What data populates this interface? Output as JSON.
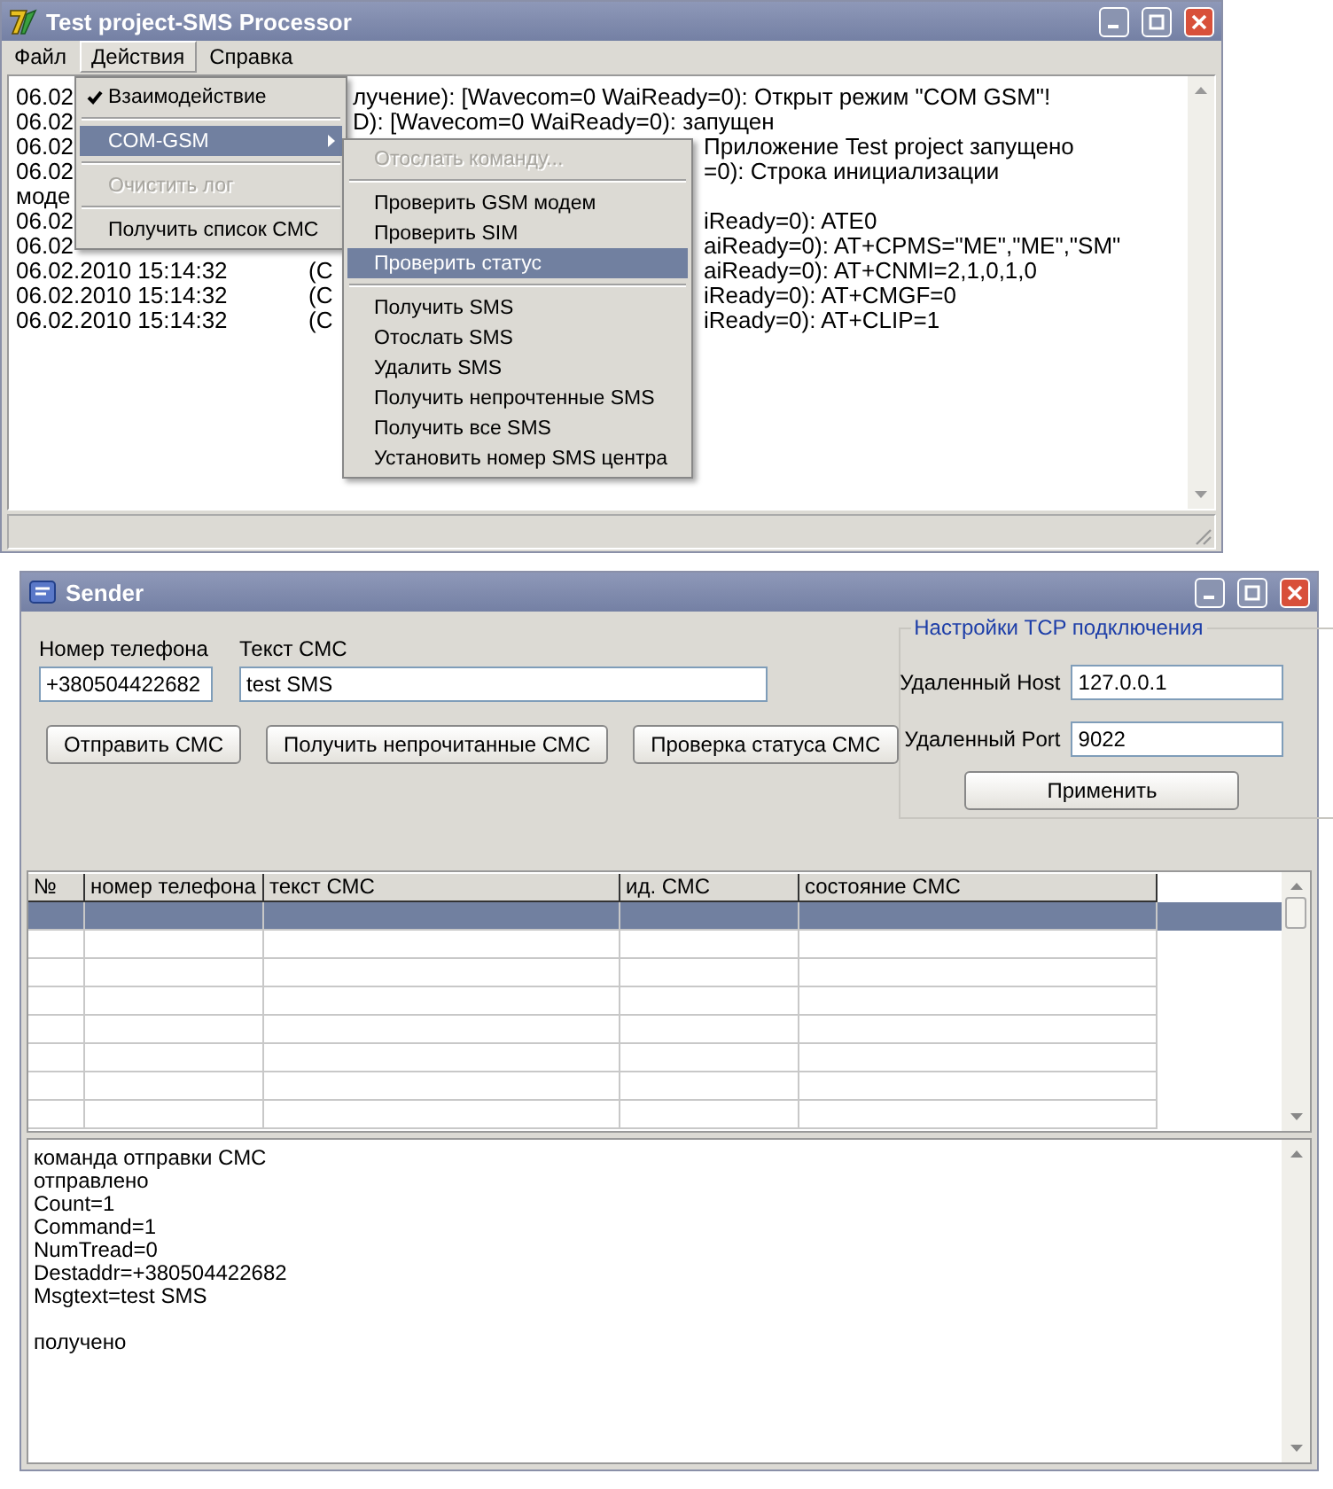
{
  "main_window": {
    "title": "Test project-SMS Processor",
    "menubar": [
      {
        "label": "Файл",
        "selected": false
      },
      {
        "label": "Действия",
        "selected": true
      },
      {
        "label": "Справка",
        "selected": false
      }
    ],
    "log": [
      {
        "kind": "after-menu",
        "date": "06.02",
        "text": "лучение): [Wavecom=0 WaiReady=0): Открыт режим \"COM GSM\"!"
      },
      {
        "kind": "after-menu",
        "date": "06.02",
        "text": "D): [Wavecom=0 WaiReady=0): запущен"
      },
      {
        "kind": "after-submenu",
        "date": "06.02",
        "text": "Приложение Test project запущено"
      },
      {
        "kind": "after-submenu",
        "date": "06.02",
        "text": "=0): Строка инициализации"
      },
      {
        "kind": "after-submenu",
        "date": "моде"
      },
      {
        "kind": "after-submenu",
        "date": "06.02",
        "text": "iReady=0): ATE0"
      },
      {
        "kind": "after-submenu",
        "date": "06.02",
        "text": "aiReady=0): AT+CPMS=\"ME\",\"ME\",\"SM\""
      },
      {
        "kind": "after-submenu",
        "date": "06.02.2010 15:14:32",
        "source": "(C",
        "text": "aiReady=0): AT+CNMI=2,1,0,1,0"
      },
      {
        "kind": "after-submenu",
        "date": "06.02.2010 15:14:32",
        "source": "(C",
        "text": "iReady=0): AT+CMGF=0"
      },
      {
        "kind": "after-submenu",
        "date": "06.02.2010 15:14:32",
        "source": "(C",
        "text": "iReady=0): AT+CLIP=1"
      }
    ],
    "menu": [
      {
        "kind": "item",
        "label": "Взаимодействие",
        "checked": true,
        "disabled": false,
        "selected": false,
        "submenu": false
      },
      {
        "kind": "separator"
      },
      {
        "kind": "item",
        "label": "COM-GSM",
        "checked": false,
        "disabled": false,
        "selected": true,
        "submenu": true
      },
      {
        "kind": "separator"
      },
      {
        "kind": "item",
        "label": "Очистить лог",
        "checked": false,
        "disabled": true,
        "selected": false,
        "submenu": false
      },
      {
        "kind": "separator"
      },
      {
        "kind": "item",
        "label": "Получить список СМС",
        "checked": false,
        "disabled": false,
        "selected": false,
        "submenu": false
      }
    ],
    "submenu": [
      {
        "kind": "item",
        "label": "Отослать команду...",
        "disabled": true,
        "selected": false
      },
      {
        "kind": "separator"
      },
      {
        "kind": "item",
        "label": "Проверить GSM модем",
        "disabled": false,
        "selected": false
      },
      {
        "kind": "item",
        "label": "Проверить SIM",
        "disabled": false,
        "selected": false
      },
      {
        "kind": "item",
        "label": "Проверить статус",
        "disabled": false,
        "selected": true
      },
      {
        "kind": "separator"
      },
      {
        "kind": "item",
        "label": "Получить SMS",
        "disabled": false,
        "selected": false
      },
      {
        "kind": "item",
        "label": "Отослать SMS",
        "disabled": false,
        "selected": false
      },
      {
        "kind": "item",
        "label": "Удалить SMS",
        "disabled": false,
        "selected": false
      },
      {
        "kind": "item",
        "label": "Получить непрочтенные SMS",
        "disabled": false,
        "selected": false
      },
      {
        "kind": "item",
        "label": "Получить все SMS",
        "disabled": false,
        "selected": false
      },
      {
        "kind": "item",
        "label": "Установить номер SMS центра",
        "disabled": false,
        "selected": false
      }
    ]
  },
  "sender_window": {
    "title": "Sender",
    "phone": {
      "label": "Номер телефона",
      "value": "+380504422682"
    },
    "message": {
      "label": "Текст СМС",
      "value": "test SMS"
    },
    "buttons": [
      "Отправить СМС",
      "Получить непрочитанные СМС",
      "Проверка статуса СМС"
    ],
    "tcp_settings": {
      "title": "Настройки TCP подключения",
      "host": {
        "label": "Удаленный Host",
        "value": "127.0.0.1"
      },
      "port": {
        "label": "Удаленный Port",
        "value": "9022"
      },
      "apply_button": "Применить"
    },
    "table": {
      "columns": [
        "№",
        "номер телефона",
        "текст СМС",
        "ид. СМС",
        "состояние СМС"
      ],
      "rows": [
        {
          "selected": true
        },
        {
          "selected": false
        },
        {
          "selected": false
        },
        {
          "selected": false
        },
        {
          "selected": false
        },
        {
          "selected": false
        },
        {
          "selected": false
        },
        {
          "selected": false
        }
      ]
    },
    "output": [
      {
        "kind": "line",
        "text": "команда отправки СМС"
      },
      {
        "kind": "line",
        "text": "отправлено"
      },
      {
        "kind": "line",
        "text": "Count=1"
      },
      {
        "kind": "line",
        "text": "Command=1"
      },
      {
        "kind": "line",
        "text": "NumTread=0"
      },
      {
        "kind": "line",
        "text": "Destaddr=+380504422682"
      },
      {
        "kind": "line",
        "text": "Msgtext=test SMS"
      },
      {
        "kind": "blank"
      },
      {
        "kind": "line",
        "text": "получено"
      }
    ]
  }
}
